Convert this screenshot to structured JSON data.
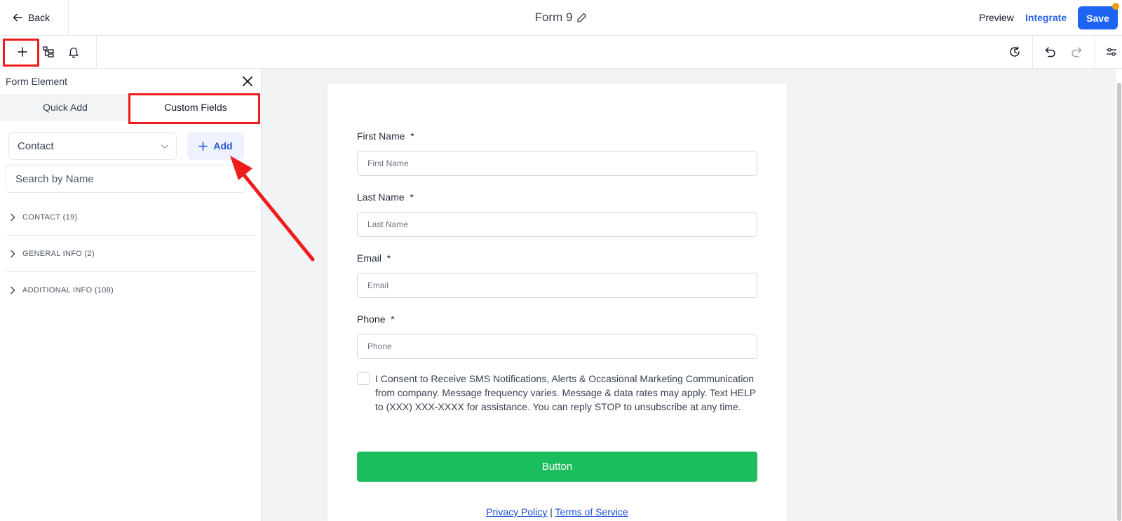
{
  "header": {
    "back_label": "Back",
    "form_title": "Form 9",
    "preview_label": "Preview",
    "integrate_label": "Integrate",
    "save_label": "Save"
  },
  "panel": {
    "title": "Form Element",
    "tabs": [
      {
        "label": "Quick Add",
        "active": false
      },
      {
        "label": "Custom Fields",
        "active": true
      }
    ],
    "object_select_value": "Contact",
    "add_label": "Add",
    "search_placeholder": "Search by Name",
    "groups": [
      {
        "label": "CONTACT (19)"
      },
      {
        "label": "GENERAL INFO (2)"
      },
      {
        "label": "ADDITIONAL INFO (108)"
      }
    ]
  },
  "form": {
    "fields": [
      {
        "label": "First Name",
        "required": "*",
        "placeholder": "First Name"
      },
      {
        "label": "Last Name",
        "required": "*",
        "placeholder": "Last Name"
      },
      {
        "label": "Email",
        "required": "*",
        "placeholder": "Email"
      },
      {
        "label": "Phone",
        "required": "*",
        "placeholder": "Phone"
      }
    ],
    "consent_text": "I Consent to Receive SMS Notifications, Alerts & Occasional Marketing Communication from company. Message frequency varies. Message & data rates may apply. Text HELP to (XXX) XXX-XXXX for assistance. You can reply STOP to unsubscribe at any time.",
    "button_label": "Button",
    "privacy_label": "Privacy Policy",
    "separator": "|",
    "terms_label": "Terms of Service"
  },
  "colors": {
    "primary": "#1d64f2",
    "link": "#2563eb",
    "submit": "#1cbd5d",
    "highlight": "#ee1c1c",
    "notify_dot": "#f59e0b"
  },
  "icons": [
    "arrow-left-icon",
    "pencil-icon",
    "plus-icon",
    "layout-icon",
    "bell-icon",
    "history-icon",
    "undo-icon",
    "redo-icon",
    "settings-sliders-icon",
    "close-icon",
    "chevron-down-icon",
    "chevron-right-icon"
  ]
}
